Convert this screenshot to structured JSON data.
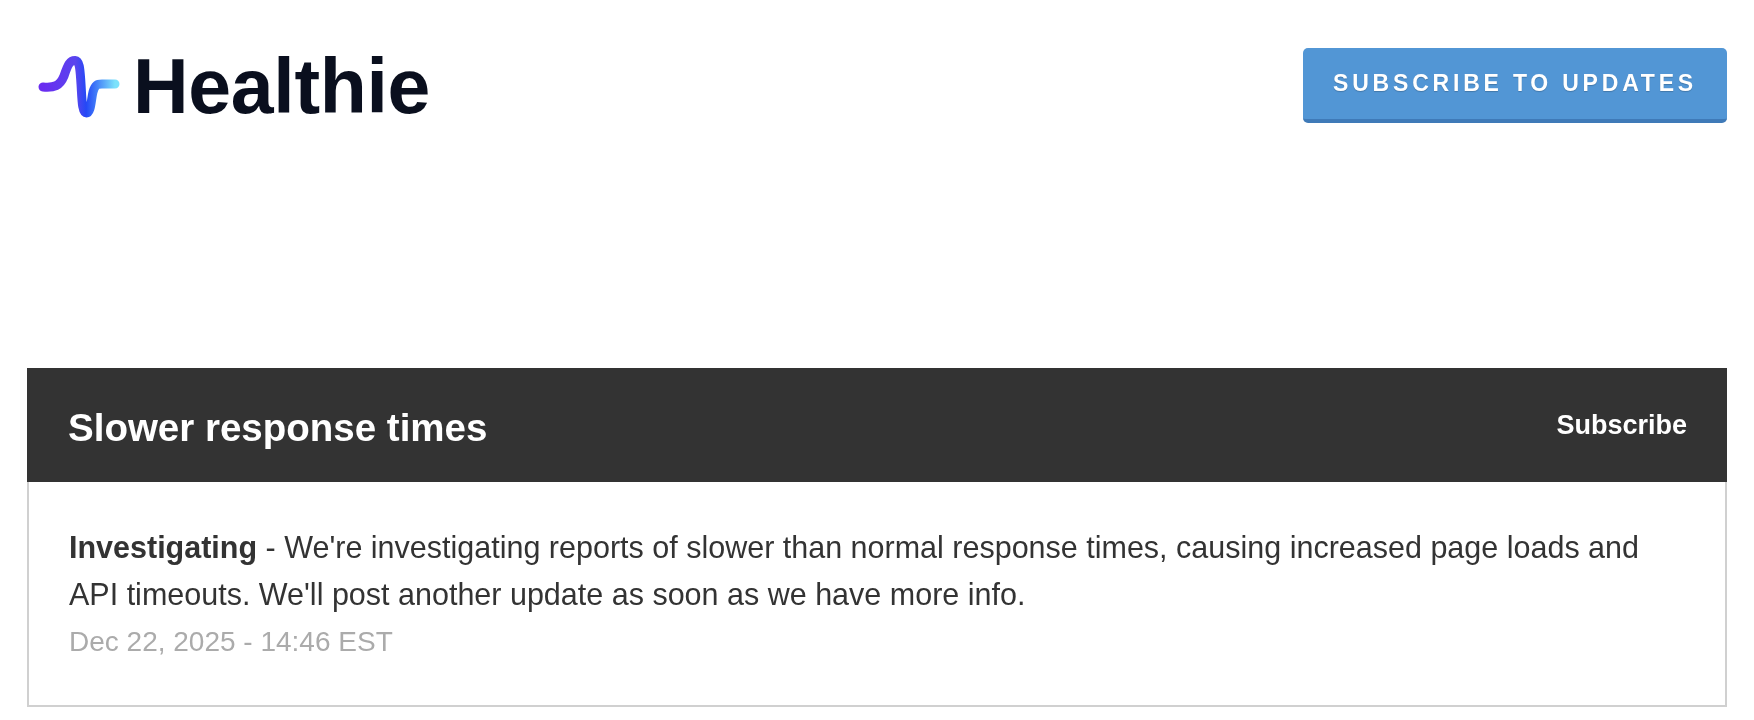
{
  "header": {
    "logo": {
      "text": "Healthie"
    },
    "subscribe_button": {
      "label": "SUBSCRIBE TO UPDATES"
    }
  },
  "incident": {
    "title": "Slower response times",
    "subscribe_link": "Subscribe",
    "updates": [
      {
        "text": "**Investigating** - We're investigating reports of slower than normal response times, causing increased page loads and API timeouts. We'll post another update as soon as we have more info.",
        "timestamp": "Dec 22, 2025 - 14:46 EST"
      }
    ]
  }
}
